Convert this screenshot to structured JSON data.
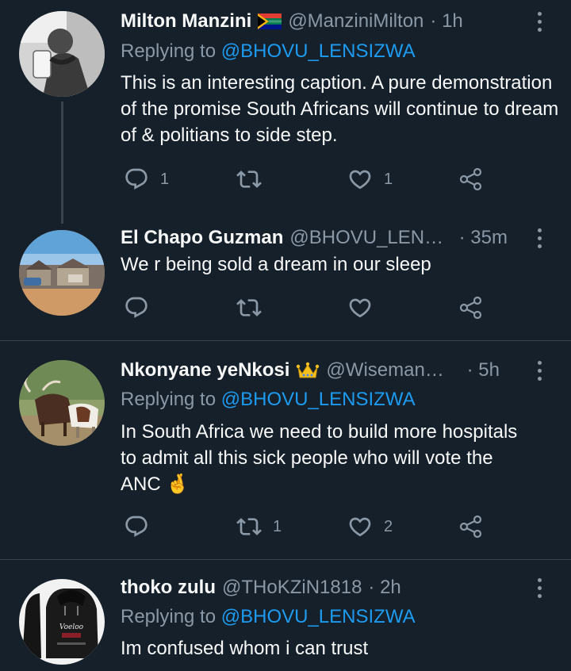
{
  "tweets": [
    {
      "name": "Milton Manzini",
      "handle": "@ManziniMilton",
      "time": "· 1h",
      "replying_prefix": "Replying to",
      "replying_to": "@BHOVU_LENSIZWA",
      "text": "This is an interesting caption. A pure demonstration of the promise South Africans will continue to dream of & politians to side step.",
      "reply_count": "1",
      "retweet_count": "",
      "like_count": "1",
      "badge_icon": "south-africa-flag-icon"
    },
    {
      "name": "El Chapo Guzman",
      "handle": "@BHOVU_LENSI...",
      "time": "· 35m",
      "text": "We r being sold a dream in our sleep",
      "reply_count": "",
      "retweet_count": "",
      "like_count": ""
    },
    {
      "name": "Nkonyane yeNkosi",
      "handle": "@WisemanSa...",
      "time": "· 5h",
      "replying_prefix": "Replying to",
      "replying_to": "@BHOVU_LENSIZWA",
      "text_lines": [
        "In South Africa we need to build more hospitals",
        "to admit all this sick people who will vote the",
        "ANC 🤞"
      ],
      "reply_count": "",
      "retweet_count": "1",
      "like_count": "2",
      "badge_icon": "crown-icon"
    },
    {
      "name": "thoko zulu",
      "handle": "@THoKZiN1818",
      "time": "· 2h",
      "replying_prefix": "Replying to",
      "replying_to": "@BHOVU_LENSIZWA",
      "text": "Im confused whom i can trust",
      "avatar_hoodie_text": "Voeloo"
    }
  ],
  "colors": {
    "background": "#15202b",
    "text": "#f7f9f9",
    "secondary": "#8b98a5",
    "link": "#1d9bf0",
    "divider": "#38444d"
  }
}
